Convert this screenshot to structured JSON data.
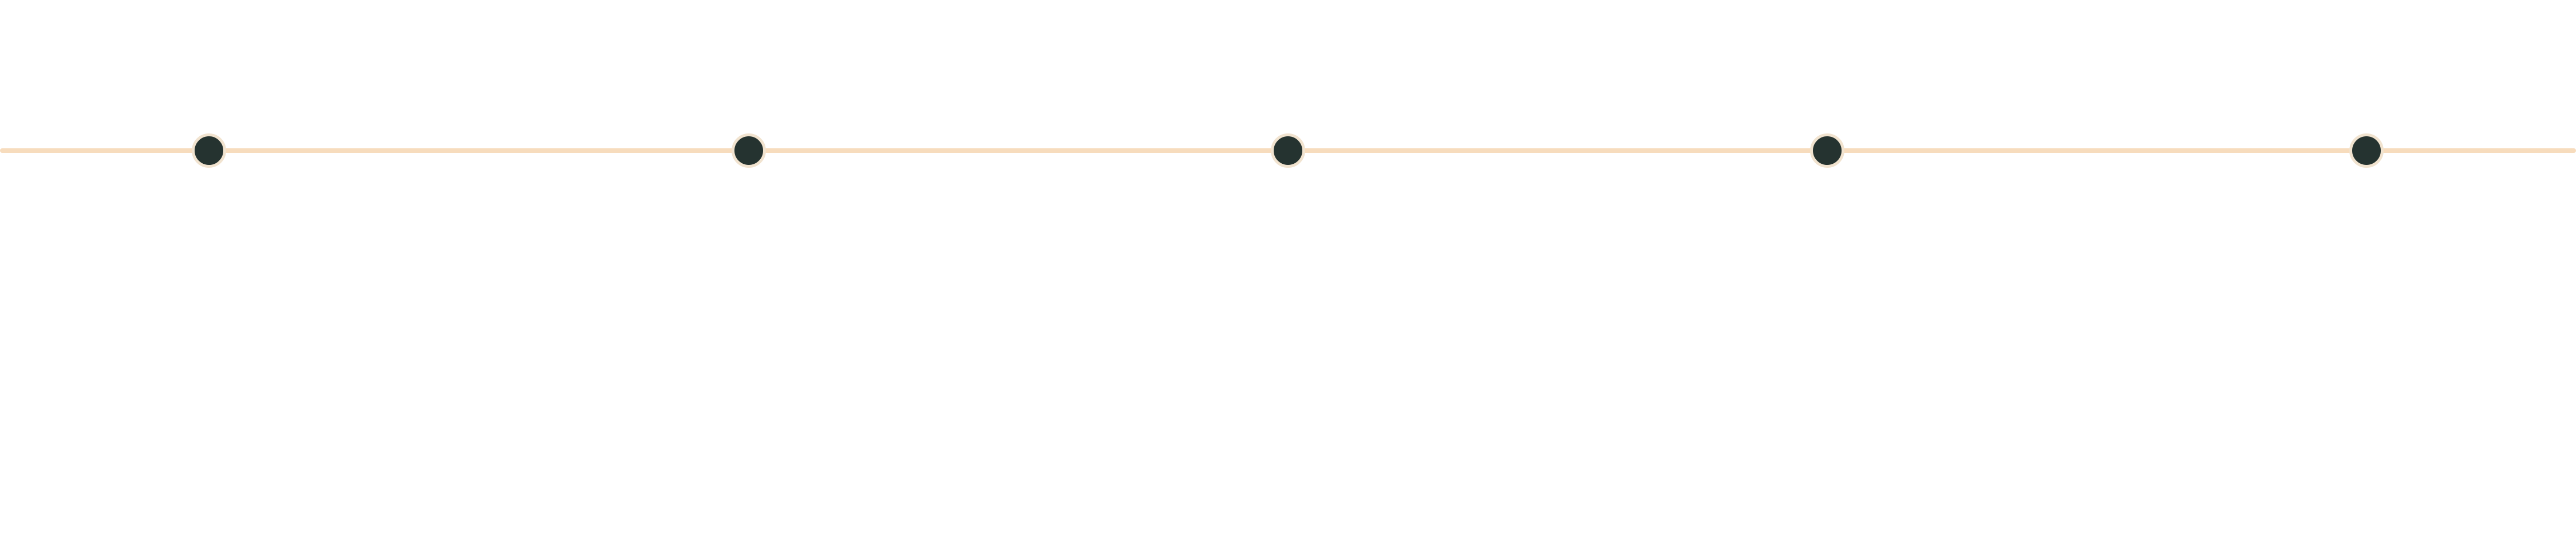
{
  "timeline": {
    "line_color": "#f7dcbd",
    "node_fill": "#253330",
    "node_border": "#f1e3cf",
    "nodes": [
      {
        "label": ""
      },
      {
        "label": ""
      },
      {
        "label": ""
      },
      {
        "label": ""
      },
      {
        "label": ""
      }
    ]
  }
}
